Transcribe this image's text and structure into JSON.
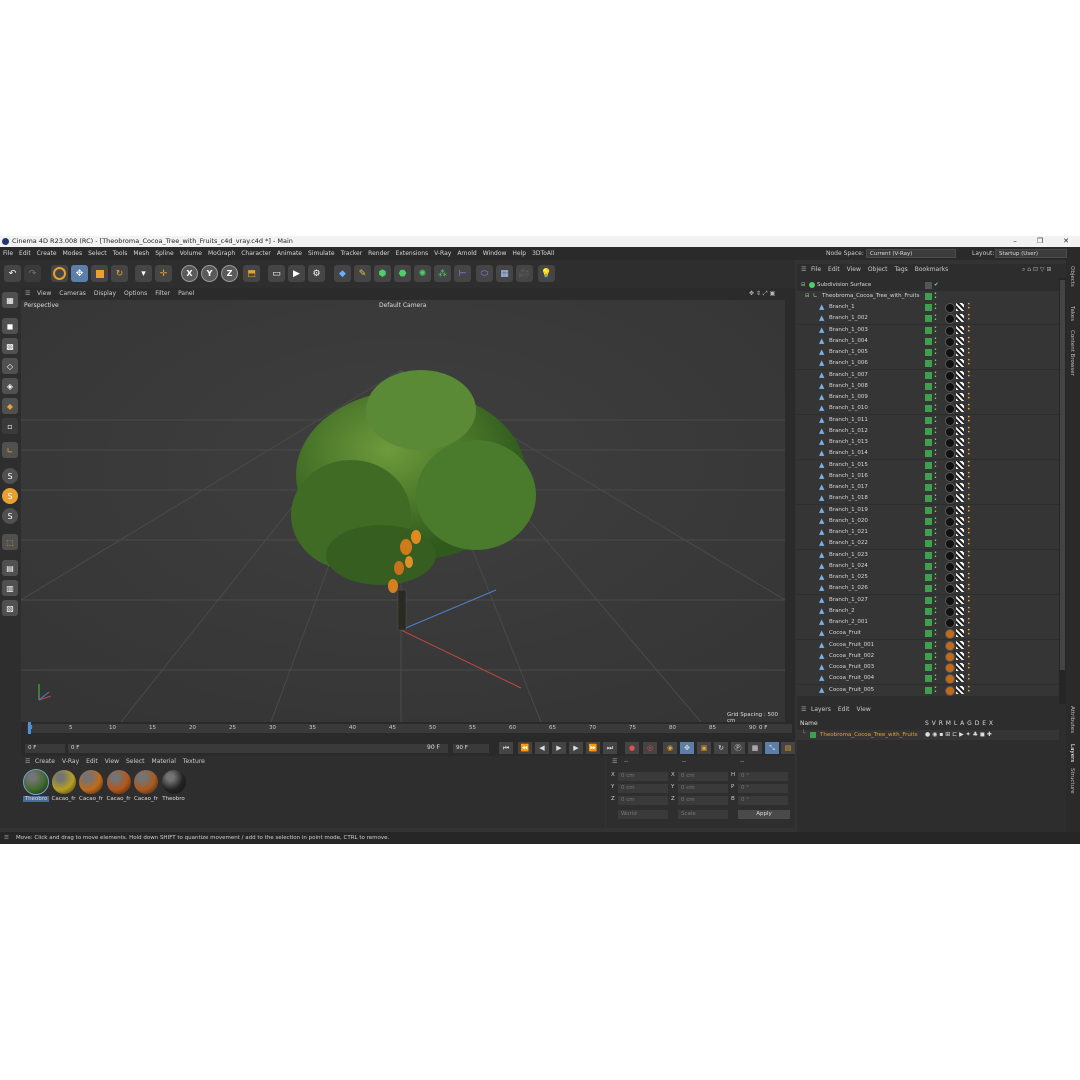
{
  "titlebar": {
    "title": "Cinema 4D R23.008 (RC) - [Theobroma_Cocoa_Tree_with_Fruits_c4d_vray.c4d *] - Main",
    "minimize": "–",
    "maximize": "❐",
    "close": "✕"
  },
  "menubar": {
    "items": [
      "File",
      "Edit",
      "Create",
      "Modes",
      "Select",
      "Tools",
      "Mesh",
      "Spline",
      "Volume",
      "MoGraph",
      "Character",
      "Animate",
      "Simulate",
      "Tracker",
      "Render",
      "Extensions",
      "V-Ray",
      "Arnold",
      "Window",
      "Help",
      "3DToAll"
    ],
    "node_space_label": "Node Space:",
    "node_space_value": "Current (V-Ray)",
    "layout_label": "Layout:",
    "layout_value": "Startup (User)"
  },
  "viewport": {
    "menu": [
      "View",
      "Cameras",
      "Display",
      "Options",
      "Filter",
      "Panel"
    ],
    "mode": "Perspective",
    "camera": "Default Camera ",
    "grid_spacing": "Grid Spacing : 500 cm"
  },
  "timeline": {
    "ticks": [
      "0",
      "5",
      "10",
      "15",
      "20",
      "25",
      "30",
      "35",
      "40",
      "45",
      "50",
      "55",
      "60",
      "65",
      "70",
      "75",
      "80",
      "85",
      "90"
    ],
    "current_frame": "0 F",
    "start": "0 F",
    "range_start": "0 F",
    "range_end": "90 F",
    "end": "90 F",
    "field_right": "0 F"
  },
  "material_manager": {
    "menu": [
      "Create",
      "V-Ray",
      "Edit",
      "View",
      "Select",
      "Material",
      "Texture"
    ],
    "materials": [
      {
        "name": "Theobro",
        "color": "#3e6b2a"
      },
      {
        "name": "Cacao_fr",
        "color": "#b8a020"
      },
      {
        "name": "Cacao_fr",
        "color": "#c26a1a"
      },
      {
        "name": "Cacao_fr",
        "color": "#b4561a"
      },
      {
        "name": "Cacao_fr",
        "color": "#a85a1e"
      },
      {
        "name": "Theobro",
        "color": "#222222"
      }
    ]
  },
  "coordinates": {
    "header": "--",
    "labels": [
      "X",
      "Y",
      "Z"
    ],
    "pos": [
      "0 cm",
      "0 cm",
      "0 cm"
    ],
    "rot_labels": [
      "X",
      "Y",
      "Z"
    ],
    "rot": [
      "0 cm",
      "0 cm",
      "0 cm"
    ],
    "size_labels": [
      "H",
      "P",
      "B"
    ],
    "size": [
      "0 °",
      "0 °",
      "0 °"
    ],
    "world": "World",
    "scale": "Scale",
    "apply": "Apply"
  },
  "object_manager": {
    "menu": [
      "File",
      "Edit",
      "View",
      "Object",
      "Tags",
      "Bookmarks"
    ],
    "subdivision": "Subdivision Surface",
    "root": "Theobroma_Cocoa_Tree_with_Fruits",
    "objects": [
      "Branch_1",
      "Branch_1_002",
      "Branch_1_003",
      "Branch_1_004",
      "Branch_1_005",
      "Branch_1_006",
      "Branch_1_007",
      "Branch_1_008",
      "Branch_1_009",
      "Branch_1_010",
      "Branch_1_011",
      "Branch_1_012",
      "Branch_1_013",
      "Branch_1_014",
      "Branch_1_015",
      "Branch_1_016",
      "Branch_1_017",
      "Branch_1_018",
      "Branch_1_019",
      "Branch_1_020",
      "Branch_1_021",
      "Branch_1_022",
      "Branch_1_023",
      "Branch_1_024",
      "Branch_1_025",
      "Branch_1_026",
      "Branch_1_027",
      "Branch_2",
      "Branch_2_001",
      "Cocoa_Fruit",
      "Cocoa_Fruit_001",
      "Cocoa_Fruit_002",
      "Cocoa_Fruit_003",
      "Cocoa_Fruit_004",
      "Cocoa_Fruit_005"
    ]
  },
  "layers": {
    "menu": [
      "Layers",
      "Edit",
      "View"
    ],
    "name_header": "Name",
    "columns": "S V R M L A G D E X",
    "layer_name": "Theobroma_Cocoa_Tree_with_Fruits"
  },
  "right_dock": [
    "Objects",
    "Takes",
    "Content Browser",
    "Attributes",
    "Layers",
    "Structure"
  ],
  "status": "Move: Click and drag to move elements. Hold down SHIFT to quantize movement / add to the selection in point mode, CTRL to remove."
}
